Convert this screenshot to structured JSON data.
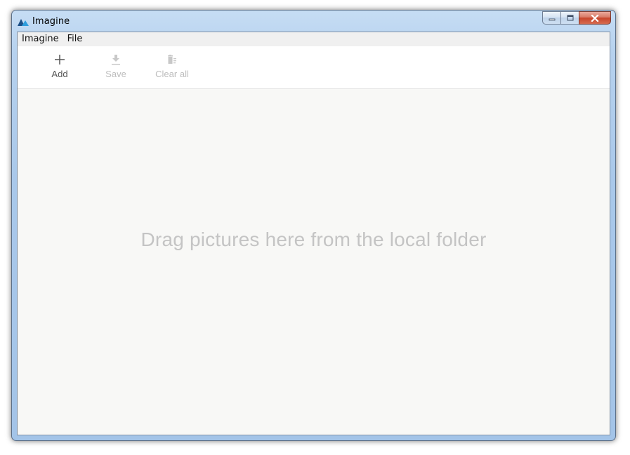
{
  "window": {
    "title": "Imagine",
    "app_icon": "imagine-mountain-icon",
    "caption_buttons": {
      "minimize_icon": "minimize-icon",
      "maximize_icon": "maximize-icon",
      "close_icon": "close-icon"
    }
  },
  "menubar": {
    "items": [
      {
        "label": "Imagine"
      },
      {
        "label": "File"
      }
    ]
  },
  "toolbar": {
    "add": {
      "label": "Add",
      "icon": "plus-icon",
      "enabled": true
    },
    "save": {
      "label": "Save",
      "icon": "download-icon",
      "enabled": false
    },
    "clear_all": {
      "label": "Clear all",
      "icon": "trash-icon",
      "enabled": false
    }
  },
  "dropzone": {
    "hint": "Drag pictures here from the local folder"
  },
  "colors": {
    "icon_accent_dark": "#1c4f86",
    "icon_accent_light": "#2d9cdb",
    "disabled_text": "#bdbdbd",
    "hint_text": "#c4c4c4",
    "close_button": "#c7452b"
  }
}
